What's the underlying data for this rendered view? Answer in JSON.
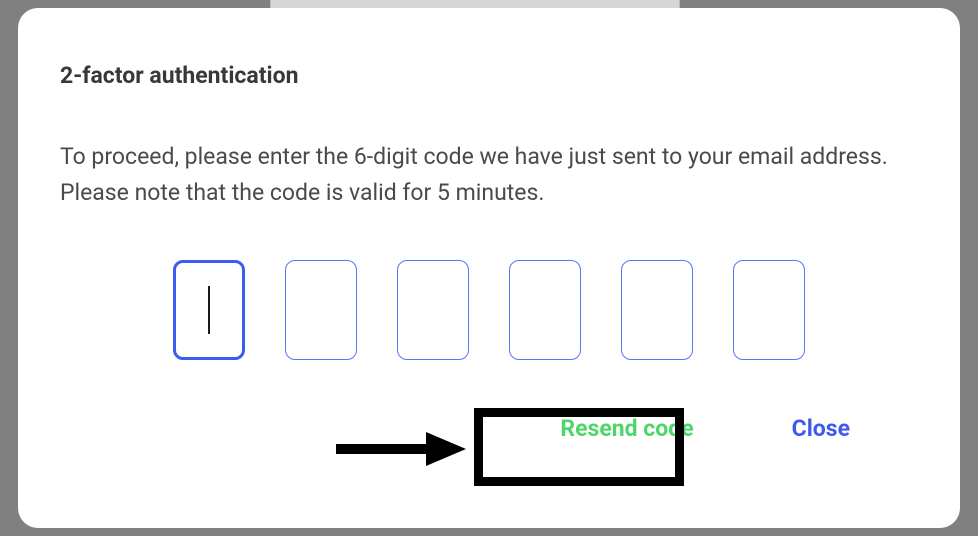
{
  "modal": {
    "title": "2-factor authentication",
    "description": "To proceed, please enter the 6-digit code we have just sent to your email address. Please note that the code is valid for 5 minutes.",
    "code_digits": [
      "",
      "",
      "",
      "",
      "",
      ""
    ],
    "focused_index": 0,
    "actions": {
      "resend_label": "Resend code",
      "close_label": "Close"
    }
  }
}
